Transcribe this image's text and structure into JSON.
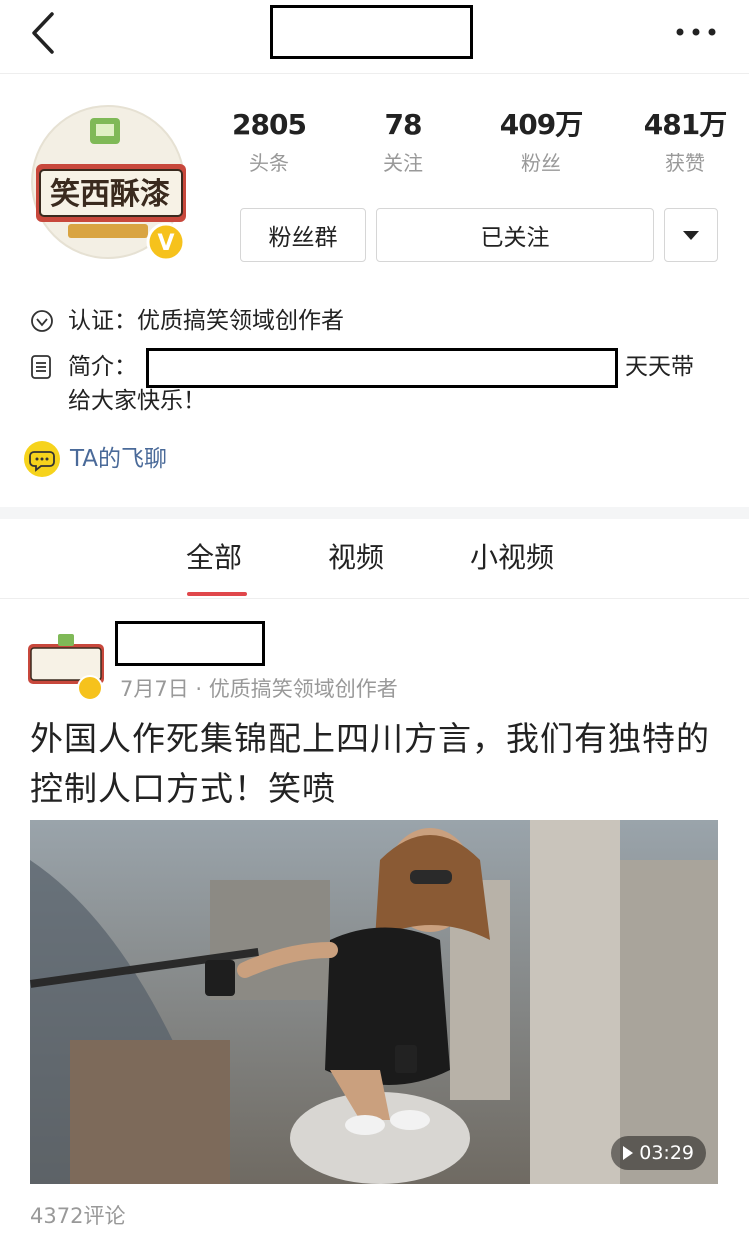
{
  "header": {
    "back_icon": "chevron-left-icon",
    "more_icon": "more-dots-icon"
  },
  "profile": {
    "avatar_text": "笑西酥漆",
    "verified_badge": "V",
    "stats": [
      {
        "value": "2805",
        "label": "头条"
      },
      {
        "value": "78",
        "label": "关注"
      },
      {
        "value": "409万",
        "label": "粉丝"
      },
      {
        "value": "481万",
        "label": "获赞"
      }
    ],
    "fans_group_label": "粉丝群",
    "follow_label": "已关注",
    "certification": "认证：优质搞笑领域创作者",
    "intro_label": "简介：",
    "intro_tail": "天天带",
    "intro_line2": "给大家快乐！",
    "chat_label": "TA的飞聊"
  },
  "tabs": [
    {
      "label": "全部",
      "active": true
    },
    {
      "label": "视频",
      "active": false
    },
    {
      "label": "小视频",
      "active": false
    }
  ],
  "post": {
    "meta": "7月7日 · 优质搞笑领域创作者",
    "title": "外国人作死集锦配上四川方言，我们有独特的控制人口方式！笑喷",
    "duration": "03:29",
    "comments": "4372评论"
  },
  "colors": {
    "accent": "#e0474b",
    "muted": "#999999",
    "link": "#4a6a99",
    "chat_yellow": "#f6d31c"
  }
}
